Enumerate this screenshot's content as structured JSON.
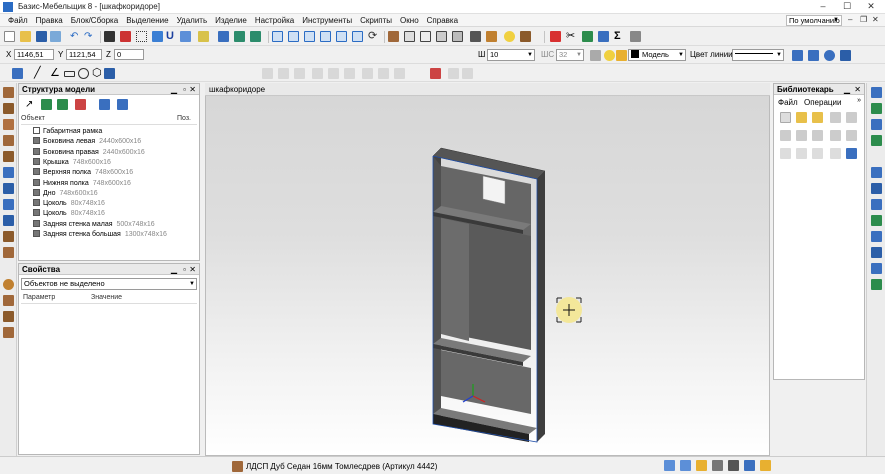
{
  "window": {
    "title": "Базис-Мебельщик 8 - [шкафкоридоре]",
    "minimize": "–",
    "maximize": "☐",
    "close": "✕"
  },
  "menu": {
    "items": [
      "Файл",
      "Правка",
      "Блок/Сборка",
      "Выделение",
      "Удалить",
      "Изделие",
      "Настройка",
      "Инструменты",
      "Скрипты",
      "Окно",
      "Справка"
    ],
    "view_mode": "По умолчанию"
  },
  "coords": {
    "x_label": "X",
    "x_value": "1146,51",
    "y_label": "Y",
    "y_value": "1121,54",
    "z_label": "Z",
    "z_value": "0"
  },
  "props_bar": {
    "w_label": "Ш",
    "w_value": "10",
    "ws_label": "ШС",
    "ws_value": "32",
    "layer_value": "Модель",
    "line_color_label": "Цвет линии"
  },
  "model_tree": {
    "title": "Структура модели",
    "col_object": "Объект",
    "col_pos": "Поз.",
    "items": [
      {
        "name": "Габаритная рамка",
        "dim": ""
      },
      {
        "name": "Боковина левая",
        "dim": "2440x600x16"
      },
      {
        "name": "Боковина правая",
        "dim": "2440x600x16"
      },
      {
        "name": "Крышка",
        "dim": "748x600x16"
      },
      {
        "name": "Верхняя полка",
        "dim": "748x600x16"
      },
      {
        "name": "Нижняя полка",
        "dim": "748x600x16"
      },
      {
        "name": "Дно",
        "dim": "748x600x16"
      },
      {
        "name": "Цоколь",
        "dim": "80x748x16"
      },
      {
        "name": "Цоколь",
        "dim": "80x748x16"
      },
      {
        "name": "Задняя стенка малая",
        "dim": "500x748x16"
      },
      {
        "name": "Задняя стенка большая",
        "dim": "1300x748x16"
      }
    ]
  },
  "properties": {
    "title": "Свойства",
    "selection": "Объектов не выделено",
    "col_param": "Параметр",
    "col_value": "Значение"
  },
  "document_tab": "шкафкоридоре",
  "library": {
    "title": "Библиотекарь",
    "menu_file": "Файл",
    "menu_ops": "Операции"
  },
  "status": {
    "material": "ЛДСП Дуб Седан 16мм Томлесдрев (Артикул 4442)"
  },
  "colors": {
    "accent": "#2b6cc4",
    "cabinet_dark": "#4a4a4a",
    "cabinet_front": "#6b6b6b",
    "cursor_glow": "#f5e68c"
  }
}
